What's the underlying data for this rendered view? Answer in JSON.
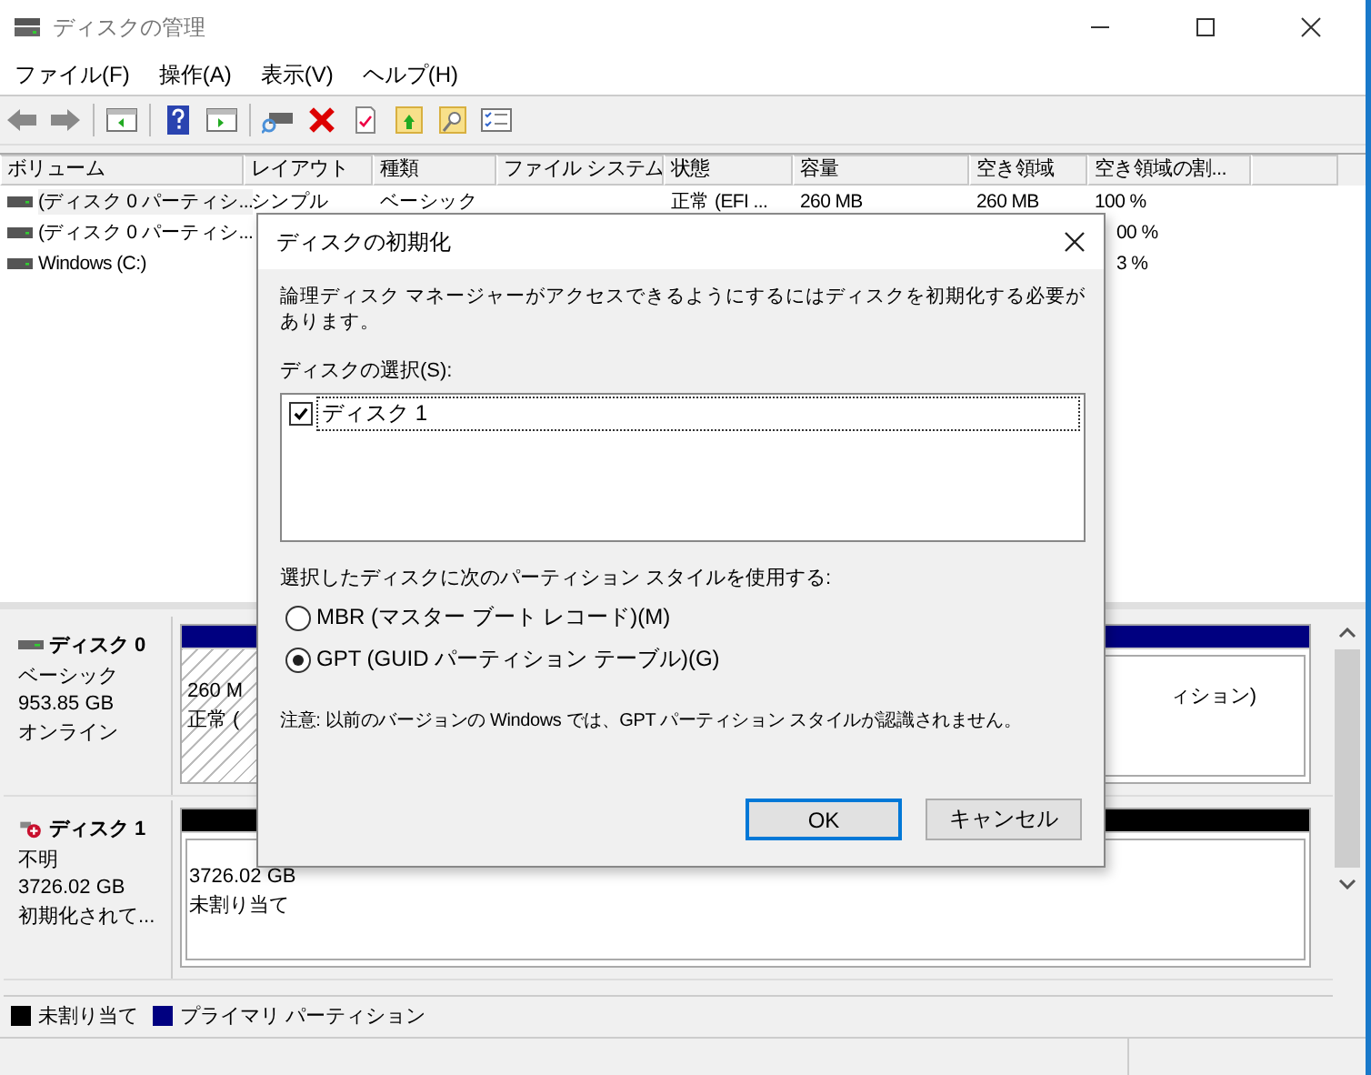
{
  "window": {
    "title": "ディスクの管理"
  },
  "menu": [
    "ファイル(F)",
    "操作(A)",
    "表示(V)",
    "ヘルプ(H)"
  ],
  "table": {
    "columns": [
      "ボリューム",
      "レイアウト",
      "種類",
      "ファイル システム",
      "状態",
      "容量",
      "空き領域",
      "空き領域の割..."
    ],
    "rows": [
      {
        "cells": [
          "(ディスク 0 パーティシ...",
          "シンプル",
          "ベーシック",
          "",
          "正常 (EFI ...",
          "260 MB",
          "260 MB",
          "100 %"
        ]
      },
      {
        "cells": [
          "(ディスク 0 パーティシ...",
          "",
          "",
          "",
          "",
          "",
          "",
          "00 %"
        ]
      },
      {
        "cells": [
          "Windows (C:)",
          "",
          "",
          "",
          "",
          "",
          "",
          "3 %"
        ]
      }
    ]
  },
  "disks": [
    {
      "name": "ディスク 0",
      "kind": "ok",
      "lines": [
        "ベーシック",
        "953.85 GB",
        "オンライン"
      ],
      "partitions": [
        {
          "kind": "hatched",
          "color": "#000080",
          "lines": [
            "260 M",
            "正常 ("
          ]
        },
        {
          "kind": "plain",
          "color": "#000080",
          "lines": [
            "ィション)"
          ]
        }
      ]
    },
    {
      "name": "ディスク 1",
      "kind": "error",
      "lines": [
        "不明",
        "3726.02 GB",
        "初期化されて..."
      ],
      "partitions": [
        {
          "kind": "plain",
          "color": "#000000",
          "lines": [
            "3726.02 GB",
            "未割り当て"
          ]
        }
      ]
    }
  ],
  "legend": [
    {
      "label": "未割り当て",
      "color": "#000000"
    },
    {
      "label": "プライマリ パーティション",
      "color": "#000080"
    }
  ],
  "dialog": {
    "title": "ディスクの初期化",
    "message": "論理ディスク マネージャーがアクセスできるようにするにはディスクを初期化する必要があります。",
    "select_label": "ディスクの選択(S):",
    "disks": [
      {
        "label": "ディスク 1",
        "checked": true
      }
    ],
    "style_label": "選択したディスクに次のパーティション スタイルを使用する:",
    "styles": [
      {
        "label": "MBR (マスター ブート レコード)(M)",
        "selected": false
      },
      {
        "label": "GPT (GUID パーティション テーブル)(G)",
        "selected": true
      }
    ],
    "note": "注意: 以前のバージョンの Windows では、GPT パーティション スタイルが認識されません。",
    "buttons": [
      {
        "label": "OK",
        "default": true
      },
      {
        "label": "キャンセル",
        "default": false
      }
    ]
  }
}
